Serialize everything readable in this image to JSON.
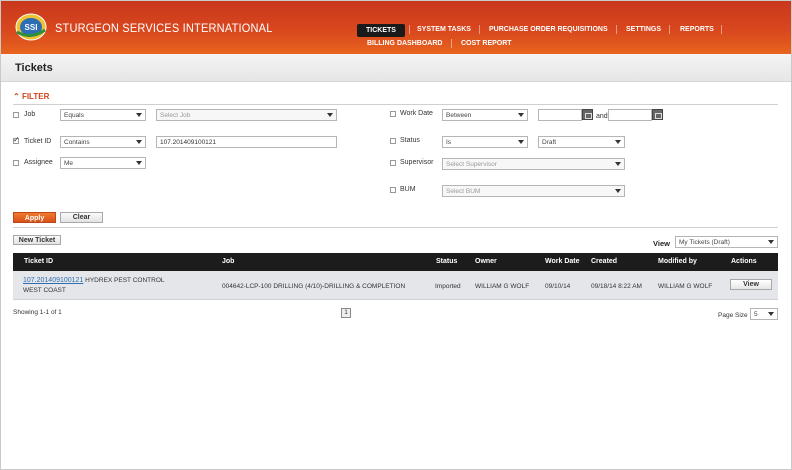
{
  "app": {
    "brand": "STURGEON SERVICES INTERNATIONAL",
    "logo_text": "SSI"
  },
  "nav": {
    "tickets": "TICKETS",
    "system_tasks": "SYSTEM TASKS",
    "purchase_order_requisitions": "PURCHASE ORDER REQUISITIONS",
    "settings": "SETTINGS",
    "reports": "REPORTS",
    "billing_dashboard": "BILLING DASHBOARD",
    "cost_report": "COST REPORT"
  },
  "page": {
    "title": "Tickets"
  },
  "filter": {
    "heading": "FILTER",
    "job": {
      "label": "Job",
      "operator": "Equals",
      "value_placeholder": "Select Job"
    },
    "ticket_id": {
      "label": "Ticket ID",
      "operator": "Contains",
      "value": "107.201409100121"
    },
    "assignee": {
      "label": "Assignee",
      "value": "Me"
    },
    "work_date": {
      "label": "Work Date",
      "operator": "Between",
      "and_label": "and"
    },
    "status": {
      "label": "Status",
      "operator": "Is",
      "value": "Draft"
    },
    "supervisor": {
      "label": "Supervisor",
      "value_placeholder": "Select Supervisor"
    },
    "bum": {
      "label": "BUM",
      "value_placeholder": "Select BUM"
    },
    "apply_label": "Apply",
    "clear_label": "Clear"
  },
  "toolbar": {
    "new_ticket_label": "New Ticket",
    "view_label": "View",
    "view_value": "My Tickets (Draft)"
  },
  "table": {
    "headers": {
      "ticket_id": "Ticket ID",
      "job": "Job",
      "status": "Status",
      "owner": "Owner",
      "work_date": "Work Date",
      "created": "Created",
      "modified_by": "Modified by",
      "actions": "Actions"
    },
    "rows": [
      {
        "ticket_id": "107.201409100121",
        "ticket_desc_1": "HYDREX PEST CONTROL",
        "ticket_desc_2": "WEST COAST",
        "job": "004642-LCP-100 DRILLING (4/10)-DRILLING & COMPLETION",
        "status": "Imported",
        "owner": "WILLIAM G WOLF",
        "work_date": "09/10/14",
        "created": "09/18/14 8:22 AM",
        "modified_by": "WILLIAM G WOLF",
        "action_label": "View"
      }
    ]
  },
  "footer": {
    "showing": "Showing 1-1 of 1",
    "page_number": "1",
    "page_size_label": "Page Size",
    "page_size_value": "5"
  },
  "colors": {
    "header_orange": "#d8471e",
    "accent_orange": "#d0451b",
    "table_header": "#1c1c1c",
    "link_blue": "#2f6fb0"
  }
}
